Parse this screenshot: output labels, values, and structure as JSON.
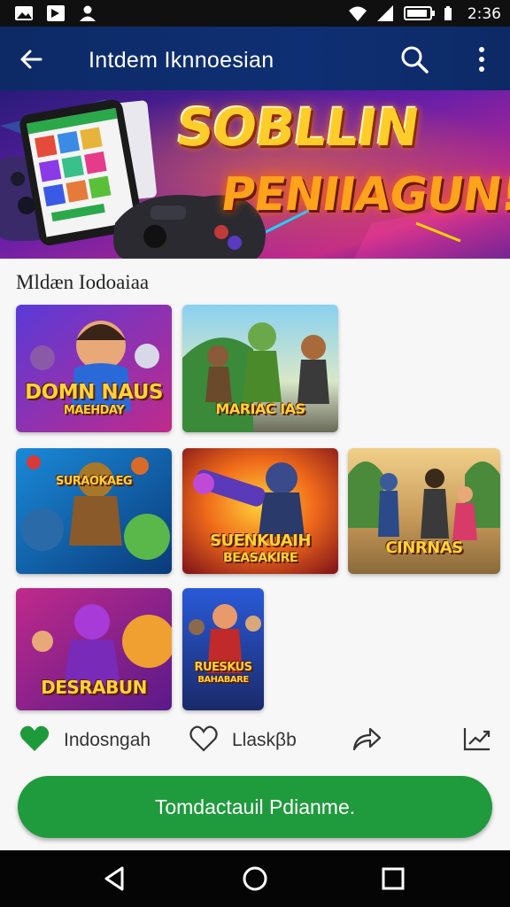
{
  "status_bar": {
    "time": "2:36",
    "icons": [
      "image-icon",
      "app-icon",
      "person-icon",
      "wifi-icon",
      "signal-icon",
      "battery-icon"
    ]
  },
  "app_bar": {
    "title": "Intdem Iknnoesian",
    "icons": [
      "back-arrow-icon",
      "search-icon",
      "more-vert-icon"
    ]
  },
  "banner": {
    "line1": "SOBLLIN",
    "line2": "PENIIAGUN!"
  },
  "section": {
    "title": "Mldæn Iodoaiaa"
  },
  "games": [
    {
      "title": "DOMN NAUS",
      "subtitle": "MAEHDAY"
    },
    {
      "title": "MARIAC IAS",
      "subtitle": ""
    },
    {
      "title": "SURAOKAEG",
      "subtitle": ""
    },
    {
      "title": "SUENKUAIH",
      "subtitle": "BEASAKIRE"
    },
    {
      "title": "CINRNAS",
      "subtitle": ""
    },
    {
      "title": "DESRABUN",
      "subtitle": ""
    },
    {
      "title": "RUESKUS",
      "subtitle": "BAHABARE"
    }
  ],
  "actions": {
    "favorite_label": "Indosngah",
    "like_label": "Llaskβb"
  },
  "cta": {
    "label": "Tomdactauil Pdianme."
  },
  "colors": {
    "appbar": "#0e2f73",
    "accent_green": "#1f9a3c",
    "heart_green": "#1e9a3a"
  }
}
